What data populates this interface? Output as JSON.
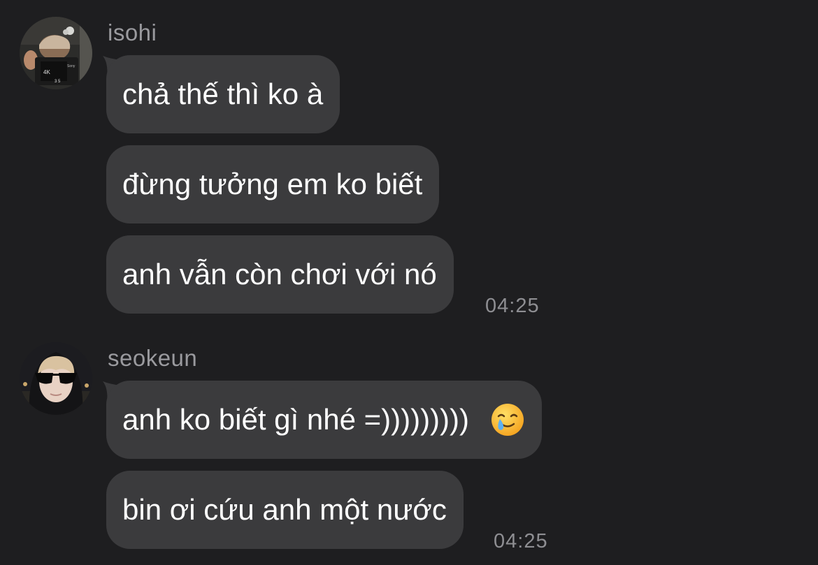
{
  "groups": [
    {
      "sender": "isohi",
      "avatar_icon": "avatar-isohi-photo-icon",
      "messages": [
        "chả thế thì ko à",
        "đừng tưởng em ko biết",
        "anh vẫn còn chơi với nó"
      ],
      "time": "04:25",
      "avatar_photo_text": {
        "line1": "4K",
        "line2": "3 5",
        "brand": "Sony"
      }
    },
    {
      "sender": "seokeun",
      "avatar_icon": "avatar-seokeun-photo-icon",
      "messages": [
        "anh ko biết gì nhé =)))))))))",
        "bin ơi cứu anh một nước"
      ],
      "emoji": "smiling-face-with-tear-icon",
      "time": "04:25"
    }
  ],
  "colors": {
    "background": "#1e1e20",
    "bubble": "#3b3b3d",
    "sender_name": "#9a9a9e",
    "timestamp": "#8e8e92",
    "message_text": "#ffffff"
  }
}
